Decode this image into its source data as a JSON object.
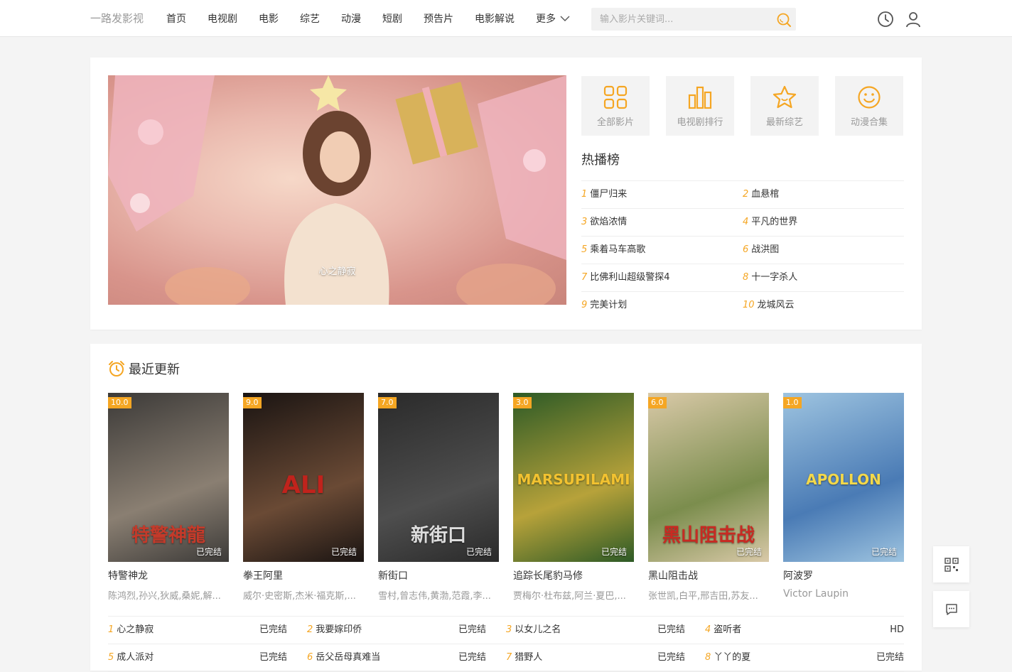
{
  "site": {
    "logo": "一路发影视"
  },
  "nav": {
    "items": [
      "首页",
      "电视剧",
      "电影",
      "综艺",
      "动漫",
      "短剧",
      "预告片",
      "电影解说"
    ],
    "more": "更多"
  },
  "search": {
    "placeholder": "输入影片关键词..."
  },
  "banner": {
    "caption": "心之静寂"
  },
  "tiles": [
    {
      "label": "全部影片",
      "icon": "grid-icon"
    },
    {
      "label": "电视剧排行",
      "icon": "bar-chart-icon"
    },
    {
      "label": "最新综艺",
      "icon": "star-icon"
    },
    {
      "label": "动漫合集",
      "icon": "smile-icon"
    }
  ],
  "hot": {
    "title": "热播榜",
    "items": [
      {
        "num": "1",
        "name": "僵尸归来"
      },
      {
        "num": "2",
        "name": "血悬棺"
      },
      {
        "num": "3",
        "name": "欲焰浓情"
      },
      {
        "num": "4",
        "name": "平凡的世界"
      },
      {
        "num": "5",
        "name": "乘着马车高歌"
      },
      {
        "num": "6",
        "name": "战洪图"
      },
      {
        "num": "7",
        "name": "比佛利山超级警探4"
      },
      {
        "num": "8",
        "name": "十一字杀人"
      },
      {
        "num": "9",
        "name": "完美计划"
      },
      {
        "num": "10",
        "name": "龙城风云"
      }
    ]
  },
  "recent": {
    "title": "最近更新",
    "posters": [
      {
        "score": "10.0",
        "status": "已完结",
        "name": "特警神龙",
        "cast": "陈鸿烈,孙兴,狄威,桑妮,解...",
        "big": "特警神龍",
        "colors": [
          "#3c3a38",
          "#8a7f72",
          "#c43a2a"
        ]
      },
      {
        "score": "9.0",
        "status": "已完结",
        "name": "拳王阿里",
        "cast": "威尔·史密斯,杰米·福克斯,...",
        "big": "ALI",
        "colors": [
          "#1a1412",
          "#6a4a35",
          "#c0231c"
        ]
      },
      {
        "score": "7.0",
        "status": "已完结",
        "name": "新街口",
        "cast": "雪村,曾志伟,黄渤,范霞,李...",
        "big": "新街口",
        "colors": [
          "#2a2a2a",
          "#4e4e4e",
          "#dddddd"
        ]
      },
      {
        "score": "3.0",
        "status": "已完结",
        "name": "追踪长尾豹马修",
        "cast": "贾梅尔·杜布兹,阿兰·夏巴,...",
        "big": "MARSUPILAMI",
        "colors": [
          "#2d5a26",
          "#b7a23a",
          "#f2c230"
        ]
      },
      {
        "score": "6.0",
        "status": "已完结",
        "name": "黑山阻击战",
        "cast": "张世凯,白平,邢吉田,苏友...",
        "big": "黑山阻击战",
        "colors": [
          "#d9c9a8",
          "#7b8d4d",
          "#c82a22"
        ]
      },
      {
        "score": "1.0",
        "status": "已完结",
        "name": "阿波罗",
        "cast": "Victor Laupin",
        "big": "APOLLON",
        "colors": [
          "#9ec4e0",
          "#4a7bb5",
          "#f3d84a"
        ]
      }
    ]
  },
  "updates": [
    [
      {
        "num": "1",
        "name": "心之静寂",
        "status": "已完结"
      },
      {
        "num": "2",
        "name": "我要嫁印侨",
        "status": "已完结"
      },
      {
        "num": "3",
        "name": "以女儿之名",
        "status": "已完结"
      },
      {
        "num": "4",
        "name": "盗听者",
        "status": "HD"
      }
    ],
    [
      {
        "num": "5",
        "name": "成人派对",
        "status": "已完结"
      },
      {
        "num": "6",
        "name": "岳父岳母真难当",
        "status": "已完结"
      },
      {
        "num": "7",
        "name": "猎野人",
        "status": "已完结"
      },
      {
        "num": "8",
        "name": "丫丫的夏",
        "status": "已完结"
      }
    ]
  ],
  "colors": {
    "accent": "#f5a623",
    "muted": "#999999"
  }
}
